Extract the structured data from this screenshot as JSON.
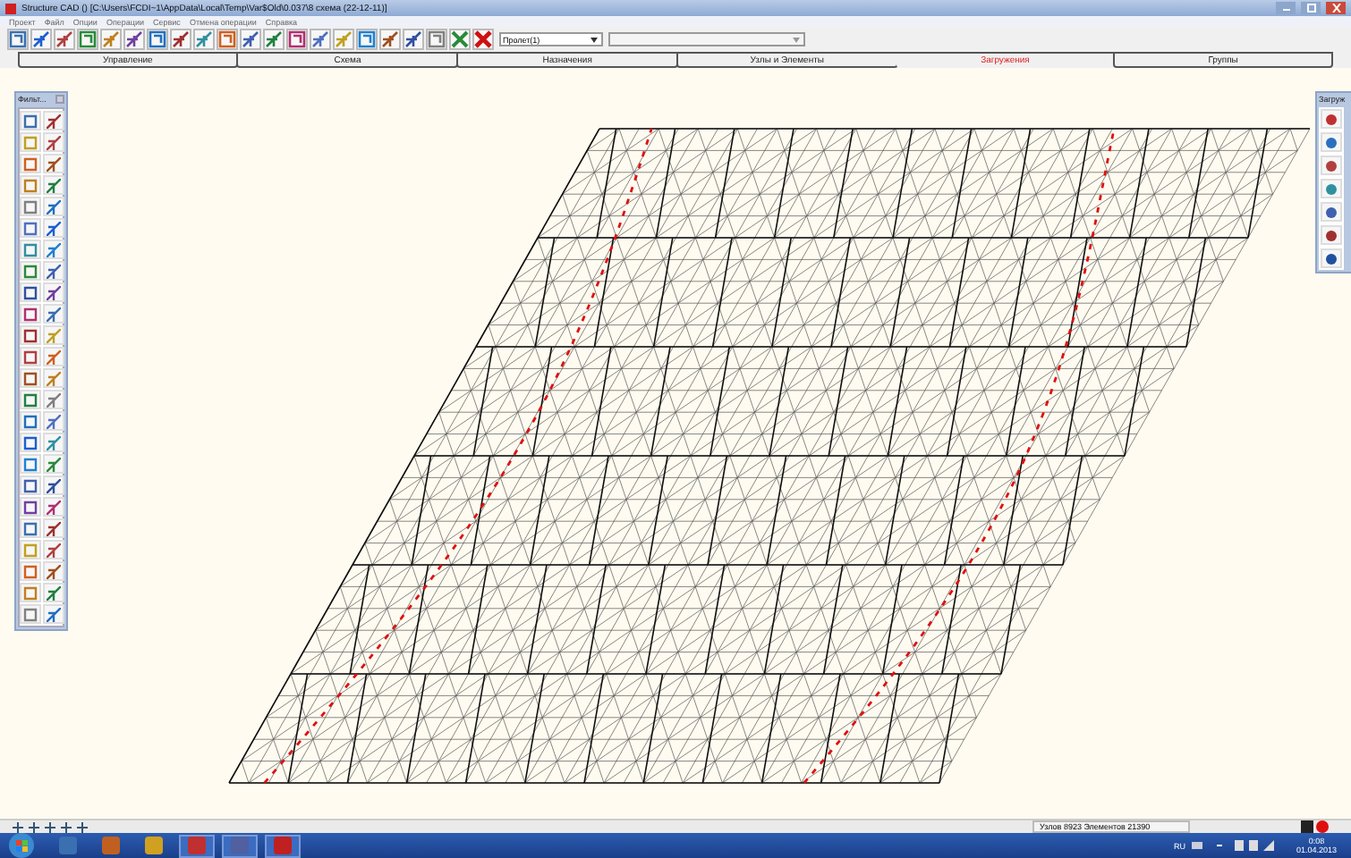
{
  "window": {
    "title": "Structure CAD () [C:\\Users\\FCDI~1\\AppData\\Local\\Temp\\Var$Old\\0.037\\8 схема (22-12-11)]"
  },
  "menu": [
    "Проект",
    "Файл",
    "Опции",
    "Операции",
    "Сервис",
    "Отмена операции",
    "Справка"
  ],
  "toolbar": {
    "dropdown": {
      "value": "Пролет(1)"
    }
  },
  "tabs": [
    {
      "label": "Управление",
      "selected": false
    },
    {
      "label": "Схема",
      "selected": false
    },
    {
      "label": "Назначения",
      "selected": false
    },
    {
      "label": "Узлы и Элементы",
      "selected": false
    },
    {
      "label": "Загружения",
      "selected": true
    },
    {
      "label": "Группы",
      "selected": false
    }
  ],
  "left_palette": {
    "title": "Фильт..."
  },
  "right_palette": {
    "title": "Загруж"
  },
  "status_bar": {
    "text": "Узлов 8923 Элементов 21390"
  },
  "taskbar": {
    "language": "RU",
    "time": "0:08",
    "date": "01.04.2013"
  }
}
